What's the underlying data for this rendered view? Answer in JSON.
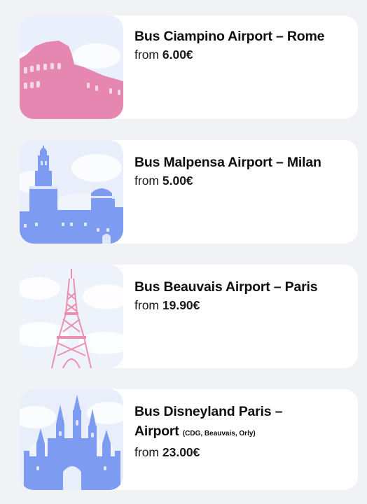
{
  "routes": [
    {
      "title": "Bus Ciampino Airport – Rome",
      "from_label": "from",
      "price": "6.00€",
      "landmark_icon": "colosseum-icon",
      "icon_color": "#e587b1"
    },
    {
      "title": "Bus Malpensa Airport – Milan",
      "from_label": "from",
      "price": "5.00€",
      "landmark_icon": "sforza-castle-icon",
      "icon_color": "#7d9cf1"
    },
    {
      "title": "Bus Beauvais Airport – Paris",
      "from_label": "from",
      "price": "19.90€",
      "landmark_icon": "eiffel-tower-icon",
      "icon_color": "#ec8fae"
    },
    {
      "title_line1": "Bus Disneyland Paris –",
      "title_line2": "Airport",
      "title_note": "(CDG, Beauvais, Orly)",
      "from_label": "from",
      "price": "23.00€",
      "landmark_icon": "disneyland-castle-icon",
      "icon_color": "#7d9cf1"
    }
  ]
}
